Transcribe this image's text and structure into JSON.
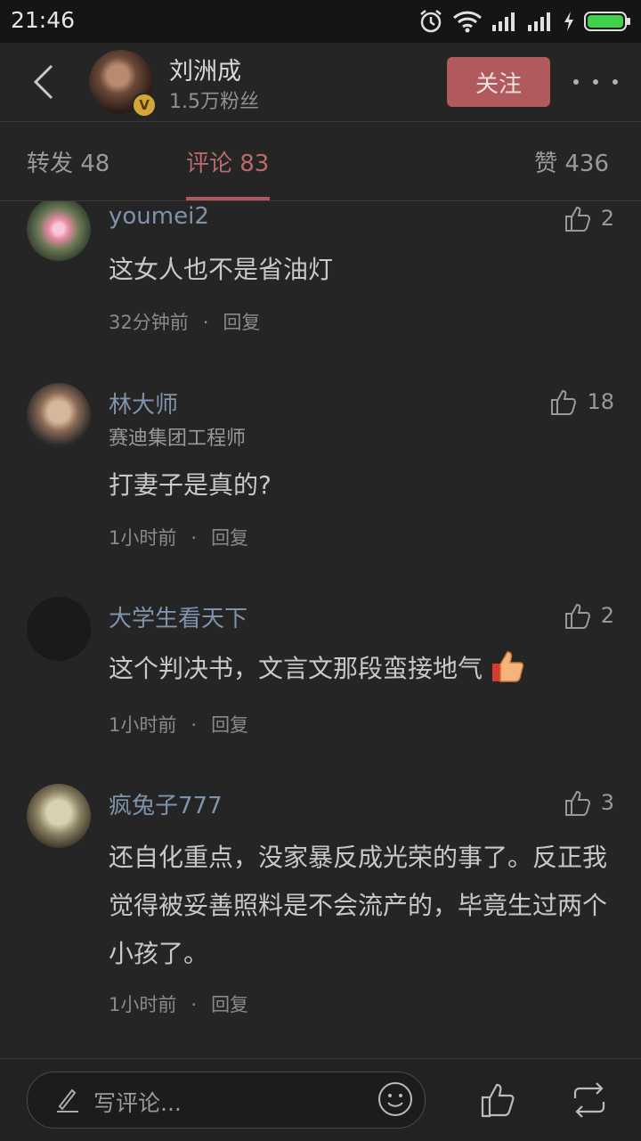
{
  "status_bar": {
    "time": "21:46"
  },
  "header": {
    "back_icon": "chevron-left-icon",
    "profile_name": "刘洲成",
    "profile_fans": "1.5万粉丝",
    "follow_label": "关注",
    "more_icon": "more-dots-icon"
  },
  "tabs": [
    {
      "label": "转发 48"
    },
    {
      "label": "评论 83",
      "active": true
    },
    {
      "label": "赞 436"
    }
  ],
  "comments": [
    {
      "name": "youmei2",
      "text": "这女人也不是省油灯",
      "time": "32分钟前",
      "reply": "回复",
      "likes": "2"
    },
    {
      "name": "林大师",
      "subtitle": "赛迪集团工程师",
      "text": "打妻子是真的?",
      "time": "1小时前",
      "reply": "回复",
      "likes": "18"
    },
    {
      "name": "大学生看天下",
      "text": "这个判决书，文言文那段蛮接地气",
      "emoji": "thumbs-up-emoji",
      "time": "1小时前",
      "reply": "回复",
      "likes": "2"
    },
    {
      "name": "疯兔子777",
      "text": "还自化重点，没家暴反成光荣的事了。反正我觉得被妥善照料是不会流产的，毕竟生过两个小孩了。",
      "time": "1小时前",
      "reply": "回复",
      "likes": "3"
    }
  ],
  "bottom_bar": {
    "placeholder": "写评论...",
    "icons": [
      "pen-icon",
      "smiley-icon",
      "thumbs-up-icon",
      "repost-icon"
    ]
  },
  "colors": {
    "accent": "#b05a5d",
    "username": "#7f93ad",
    "background": "#252525"
  }
}
